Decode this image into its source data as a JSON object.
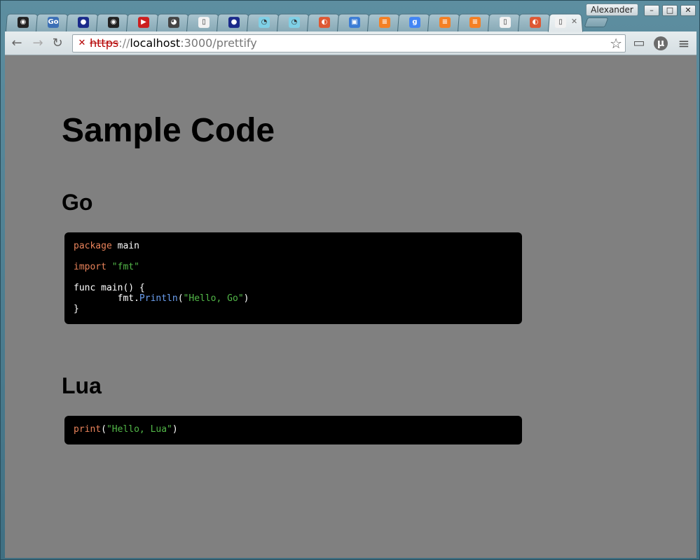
{
  "window": {
    "profile_name": "Alexander",
    "minimize_label": "–",
    "maximize_label": "□",
    "close_label": "✕"
  },
  "tabs": [
    {
      "icon": "github-icon",
      "glyph": "◉",
      "color": "#222222"
    },
    {
      "icon": "godoc-icon",
      "glyph": "Go",
      "color": "#3b6fb6"
    },
    {
      "icon": "golang-gopher-icon",
      "glyph": "●",
      "color": "#1a2a8a"
    },
    {
      "icon": "github-icon",
      "glyph": "◉",
      "color": "#222222"
    },
    {
      "icon": "youtube-icon",
      "glyph": "▶",
      "color": "#cc1f1f"
    },
    {
      "icon": "reddit-icon",
      "glyph": "◕",
      "color": "#444444"
    },
    {
      "icon": "document-icon",
      "glyph": "▯",
      "color": "#f2f2f2"
    },
    {
      "icon": "golang-gopher-icon",
      "glyph": "●",
      "color": "#1a2a8a"
    },
    {
      "icon": "gopher-icon",
      "glyph": "◔",
      "color": "#7fd0e6"
    },
    {
      "icon": "gopher-icon",
      "glyph": "◔",
      "color": "#7fd0e6"
    },
    {
      "icon": "duckduckgo-icon",
      "glyph": "◐",
      "color": "#de5833"
    },
    {
      "icon": "chat-icon",
      "glyph": "▣",
      "color": "#3a7bd5"
    },
    {
      "icon": "stackoverflow-icon",
      "glyph": "≡",
      "color": "#f48024"
    },
    {
      "icon": "google-icon",
      "glyph": "g",
      "color": "#4285f4"
    },
    {
      "icon": "stackoverflow-icon",
      "glyph": "≡",
      "color": "#f48024"
    },
    {
      "icon": "stackoverflow-icon",
      "glyph": "≡",
      "color": "#f48024"
    },
    {
      "icon": "document-icon",
      "glyph": "▯",
      "color": "#f2f2f2"
    },
    {
      "icon": "duckduckgo-icon",
      "glyph": "◐",
      "color": "#de5833"
    },
    {
      "icon": "page-icon",
      "glyph": "▯",
      "color": "#f2f2f2",
      "active": true,
      "close_label": "✕"
    }
  ],
  "toolbar": {
    "back_glyph": "←",
    "forward_glyph": "→",
    "reload_glyph": "↻",
    "url_scheme": "https",
    "url_separator": "://",
    "url_host": "localhost",
    "url_rest": ":3000/prettify",
    "insecure_glyph": "✕",
    "star_glyph": "☆",
    "cast_glyph": "▭",
    "extension_glyph": "µ",
    "menu_glyph": "≡"
  },
  "page": {
    "title": "Sample Code",
    "sections": [
      {
        "heading": "Go",
        "code_lines": [
          [
            {
              "t": "kw",
              "v": "package"
            },
            {
              "t": "pln",
              "v": " main"
            }
          ],
          [],
          [
            {
              "t": "kw",
              "v": "import"
            },
            {
              "t": "pln",
              "v": " "
            },
            {
              "t": "str",
              "v": "\"fmt\""
            }
          ],
          [],
          [
            {
              "t": "pln",
              "v": "func main() {"
            }
          ],
          [
            {
              "t": "pln",
              "v": "        fmt."
            },
            {
              "t": "typ",
              "v": "Println"
            },
            {
              "t": "pun",
              "v": "("
            },
            {
              "t": "str",
              "v": "\"Hello, Go\""
            },
            {
              "t": "pun",
              "v": ")"
            }
          ],
          [
            {
              "t": "pln",
              "v": "}"
            }
          ]
        ]
      },
      {
        "heading": "Lua",
        "code_lines": [
          [
            {
              "t": "kw",
              "v": "print"
            },
            {
              "t": "pun",
              "v": "("
            },
            {
              "t": "str",
              "v": "\"Hello, Lua\""
            },
            {
              "t": "pun",
              "v": ")"
            }
          ]
        ]
      }
    ]
  }
}
